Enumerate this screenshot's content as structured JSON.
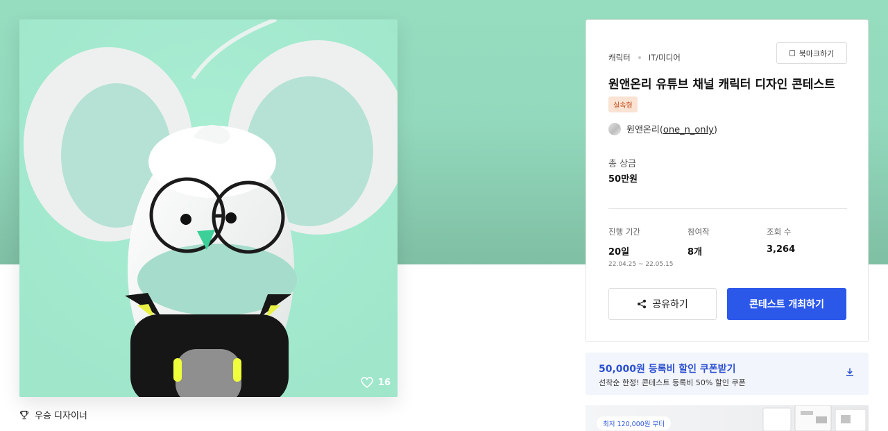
{
  "artwork": {
    "like_count": "16",
    "like_icon": "heart-icon"
  },
  "award": {
    "icon": "trophy-icon",
    "label": "우승 디자이너"
  },
  "contest": {
    "category": "캐릭터",
    "subcategory": "IT/미디어",
    "bookmark_label": "북마크하기",
    "title": "원앤온리 유튜브 채널 캐릭터 디자인 콘테스트",
    "badge": "실속형",
    "host_name": "원앤온리",
    "host_paren_open": "(",
    "host_handle": "one_n_only",
    "host_paren_close": ")",
    "prize_label": "총 상금",
    "prize_value": "50만원",
    "stats": {
      "period_label": "진행 기간",
      "period_value": "20일",
      "period_range": "22.04.25 ~ 22.05.15",
      "participants_label": "참여작",
      "participants_value": "8개",
      "views_label": "조회 수",
      "views_value": "3,264"
    },
    "share_label": "공유하기",
    "host_button_label": "콘테스트 개최하기"
  },
  "coupon": {
    "title": "50,000원 등록비 할인 쿠폰받기",
    "subtitle": "선착순 한정! 콘테스트 등록비 50% 할인 쿠폰",
    "icon": "download-icon"
  },
  "promo": {
    "pill": "최저 120,000원 부터"
  },
  "colors": {
    "hero_bg": "#96dcbf",
    "artwork_bg": "#a2e8cd",
    "primary": "#2c58ea",
    "coupon_text": "#2b4fd0",
    "badge_bg": "#fbe3d4",
    "badge_text": "#c24e17"
  }
}
